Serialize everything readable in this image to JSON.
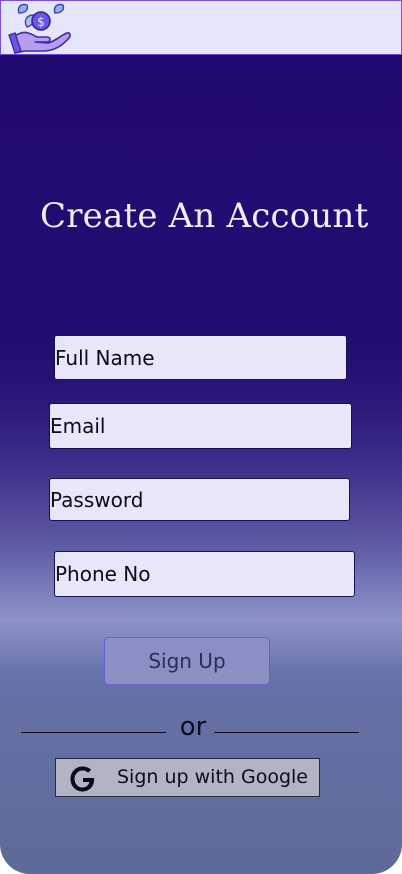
{
  "header": {
    "logo_icon": "hand-coin-icon"
  },
  "form": {
    "title": "Create An Account",
    "full_name_placeholder": "Full Name",
    "email_placeholder": "Email",
    "password_placeholder": "Password",
    "phone_placeholder": "Phone No",
    "signup_label": "Sign Up",
    "divider_text": "or",
    "google_label": "Sign up with Google",
    "google_icon": "google-g-icon"
  },
  "colors": {
    "panel_top": "#210a70",
    "panel_bottom": "#5e6b98",
    "field_bg": "#e8e6f8",
    "button_bg": "#8a8fc4",
    "header_bg": "#e6e6fb"
  }
}
